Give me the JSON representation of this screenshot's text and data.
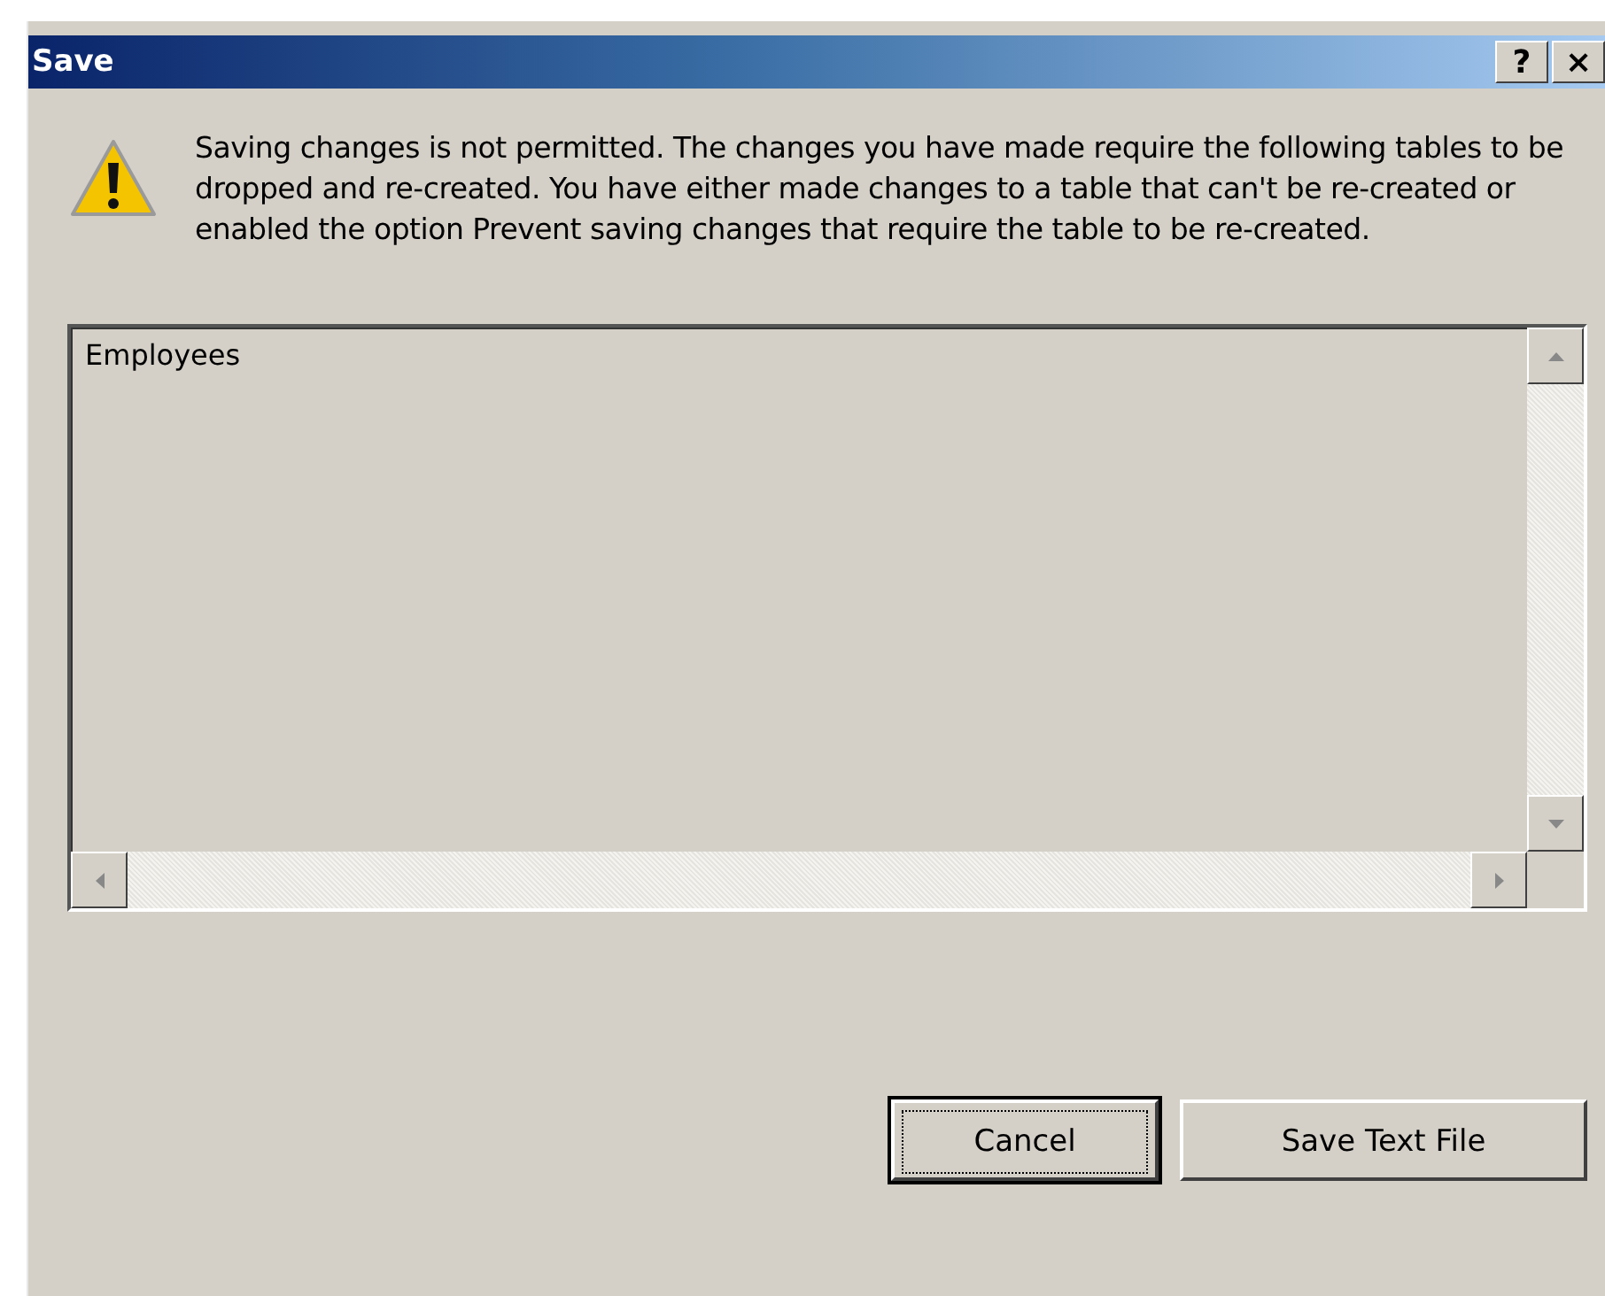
{
  "window": {
    "title": "Save",
    "title_buttons": [
      "?",
      "×"
    ]
  },
  "message": "Saving changes is not permitted. The changes you have made require the following tables to be dropped and re-created. You have either made changes to a table that can't be re-created or enabled the option Prevent saving changes that require the table to be re-created.",
  "tables": [
    "Employees"
  ],
  "buttons": [
    {
      "label": "Cancel",
      "focused": true
    },
    {
      "label": "Save Text File",
      "focused": false
    }
  ]
}
